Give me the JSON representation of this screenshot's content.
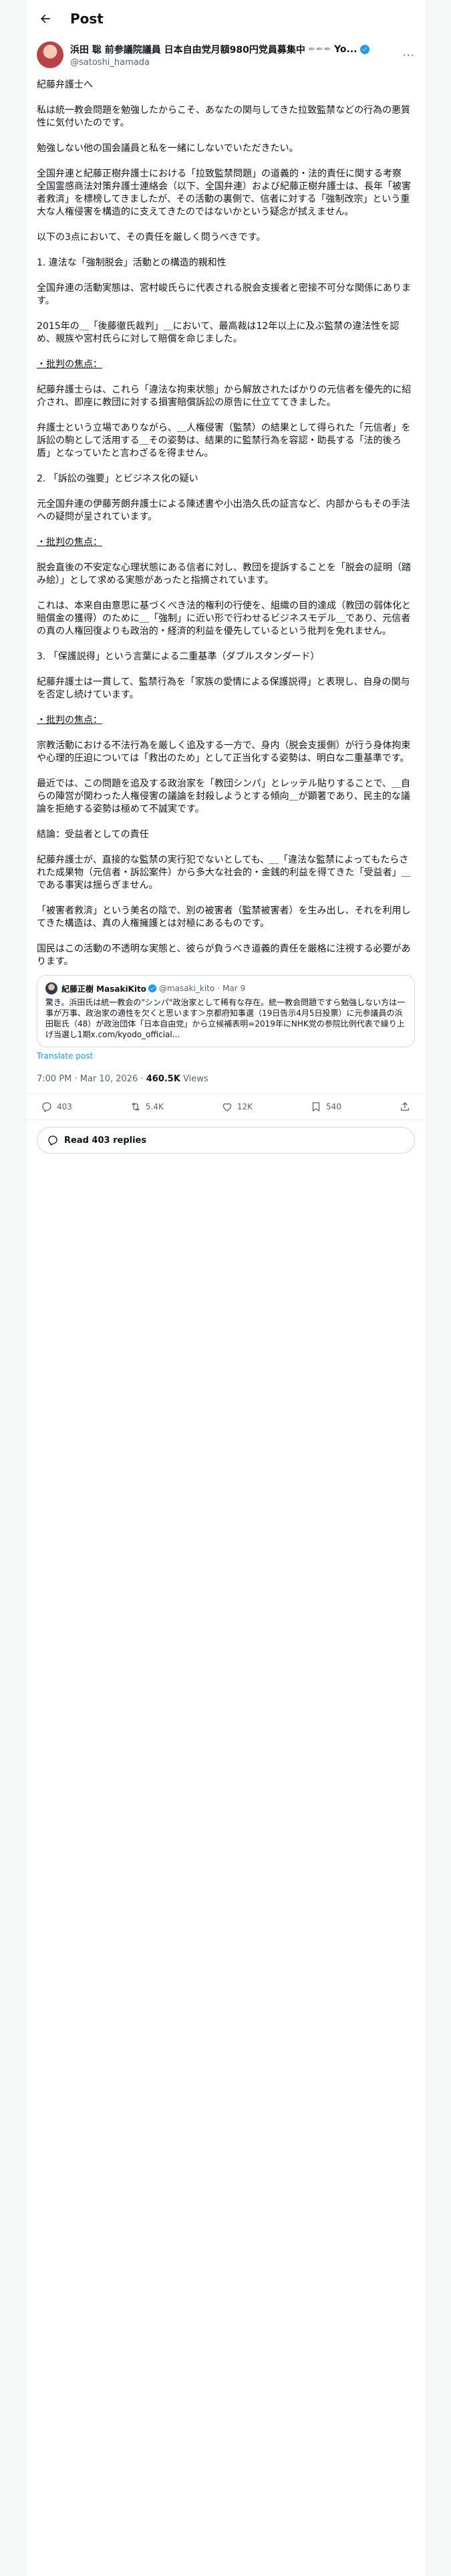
{
  "header": {
    "title": "Post"
  },
  "author": {
    "display_name": "浜田 聡 前参議院議員 日本自由党月額980円党員募集中",
    "name_suffix": "Yo...",
    "handle": "@satoshi_hamada",
    "more_label": "···"
  },
  "paragraphs": [
    "紀藤弁護士へ",
    "私は統一教会問題を勉強したからこそ、あなたの関与してきた拉致監禁などの行為の悪質性に気付いたのです。",
    "勉強しない他の国会議員と私を一緒にしないでいただきたい。",
    "全国弁連と紀藤正樹弁護士における「拉致監禁問題」の道義的・法的責任に関する考察\n全国霊感商法対策弁護士連絡会（以下、全国弁連）および紀藤正樹弁護士は、長年「被害者救済」を標榜してきましたが、その活動の裏側で、信者に対する「強制改宗」という重大な人権侵害を構造的に支えてきたのではないかという疑念が拭えません。",
    "以下の3点において、その責任を厳しく問うべきです。",
    "1. 違法な「強制脱会」活動との構造的親和性",
    "全国弁連の活動実態は、宮村峻氏らに代表される脱会支援者と密接不可分な関係にあります。",
    "2015年の＿「後藤徹氏裁判」＿において、最高裁は12年以上に及ぶ監禁の違法性を認め、親族や宮村氏らに対して賠償を命じました。",
    "・批判の焦点：",
    "紀藤弁護士らは、これら「違法な拘束状態」から解放されたばかりの元信者を優先的に紹介され、即座に教団に対する損害賠償訴訟の原告に仕立ててきました。",
    "弁護士という立場でありながら、＿人権侵害（監禁）の結果として得られた「元信者」を訴訟の駒として活用する＿その姿勢は、結果的に監禁行為を容認・助長する「法的後ろ盾」となっていたと言わざるを得ません。",
    "2. 「訴訟の強要」とビジネス化の疑い",
    "元全国弁連の伊藤芳朗弁護士による陳述書や小出浩久氏の証言など、内部からもその手法への疑問が呈されています。",
    "・批判の焦点：",
    "脱会直後の不安定な心理状態にある信者に対し、教団を提訴することを「脱会の証明（踏み絵）」として求める実態があったと指摘されています。",
    "これは、本来自由意思に基づくべき法的権利の行使を、組織の目的達成（教団の弱体化と賠償金の獲得）のために＿「強制」に近い形で行わせるビジネスモデル＿であり、元信者の真の人権回復よりも政治的・経済的利益を優先しているという批判を免れません。",
    "3. 「保護説得」という言葉による二重基準（ダブルスタンダード）",
    "紀藤弁護士は一貫して、監禁行為を「家族の愛情による保護説得」と表現し、自身の関与を否定し続けています。",
    "・批判の焦点：",
    "宗教活動における不法行為を厳しく追及する一方で、身内（脱会支援側）が行う身体拘束や心理的圧迫については「救出のため」として正当化する姿勢は、明白な二重基準です。",
    "最近では、この問題を追及する政治家を「教団シンパ」とレッテル貼りすることで、＿自らの陣営が関わった人権侵害の議論を封殺しようとする傾向＿が顕著であり、民主的な議論を拒絶する姿勢は極めて不誠実です。",
    "結論：受益者としての責任",
    "紀藤弁護士が、直接的な監禁の実行犯でないとしても、＿「違法な監禁によってもたらされた成果物（元信者・訴訟案件）から多大な社会的・金銭的利益を得てきた「受益者」＿である事実は揺らぎません。",
    "「被害者救済」という美名の陰で、別の被害者（監禁被害者）を生み出し、それを利用してきた構造は、真の人権擁護とは対極にあるものです。",
    "国民はこの活動の不透明な実態と、彼らが負うべき道義的責任を厳格に注視する必要があります。"
  ],
  "quote": {
    "name": "紀藤正樹 MasakiKito",
    "handle": "@masaki_kito",
    "date": "Mar 9",
    "text": "驚き。浜田氏は統一教会の\"シンパ\"政治家として稀有な存在。統一教会問題ですら勉強しない方は一事が万事、政治家の適性を欠くと思います＞京都府知事選（19日告示4月5日投票）に元参議員の浜田聡氏（48）が政治団体「日本自由党」から立候補表明=2019年にNHK党の参院比例代表で繰り上げ当選し1期x.com/kyodo_official..."
  },
  "translate_label": "Translate post",
  "meta": {
    "time": "7:00 PM · Mar 10, 2026",
    "views_count": "460.5K",
    "views_label": "Views"
  },
  "actions": {
    "replies": "403",
    "reposts": "5.4K",
    "likes": "12K",
    "bookmarks": "540"
  },
  "read_replies_label": "Read 403 replies",
  "colors": {
    "accent": "#1d9bf0",
    "text": "#0f1419",
    "muted": "#536471"
  }
}
